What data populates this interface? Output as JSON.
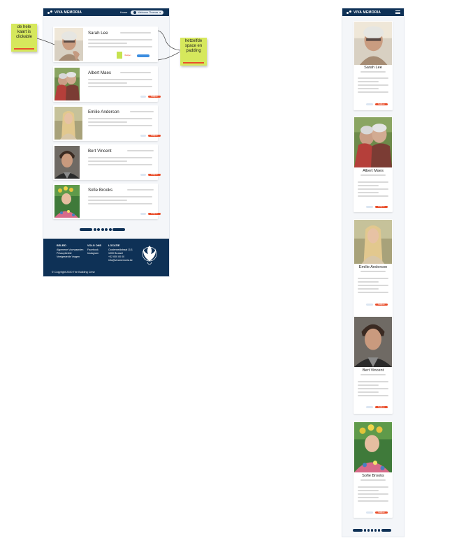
{
  "brand": {
    "logo_text": "VIVA MEMORIA",
    "primary": "#0e3156",
    "accent": "#e94e2b",
    "sticky": "#d6e85c"
  },
  "desktop": {
    "nav_label": "Home",
    "login_label": "Welcome Thomas",
    "people": [
      "Sarah Lee",
      "Albert Maes",
      "Emilie Anderson",
      "Bert Vincent",
      "Sofie Brooks"
    ],
    "red_button_label": "Bekijken",
    "footer": {
      "col1": {
        "heading": "BELEID",
        "items": [
          "Algemene Voorwaarden",
          "Privacybeleid",
          "Veelgestelde Vragen"
        ]
      },
      "col2": {
        "heading": "VOLG ONS",
        "items": [
          "Facebook",
          "Instagram"
        ]
      },
      "col3": {
        "heading": "LOCATIE",
        "items": [
          "Oostenveldstraat 11/1",
          "1000 Brussel",
          "+32 000 00 00",
          "info@vivamemoria.be"
        ]
      },
      "copyright": "© Copyright 2020 The Building Crew"
    }
  },
  "mobile": {
    "people": [
      "Sarah Lee",
      "Albert Maes",
      "Emilie Anderson",
      "Bert Vincent",
      "Sofie Brooks"
    ]
  },
  "notes": {
    "left": [
      "de hele",
      "kaart is",
      "clickable"
    ],
    "right": [
      "hetzelfde",
      "space en",
      "padding"
    ]
  }
}
